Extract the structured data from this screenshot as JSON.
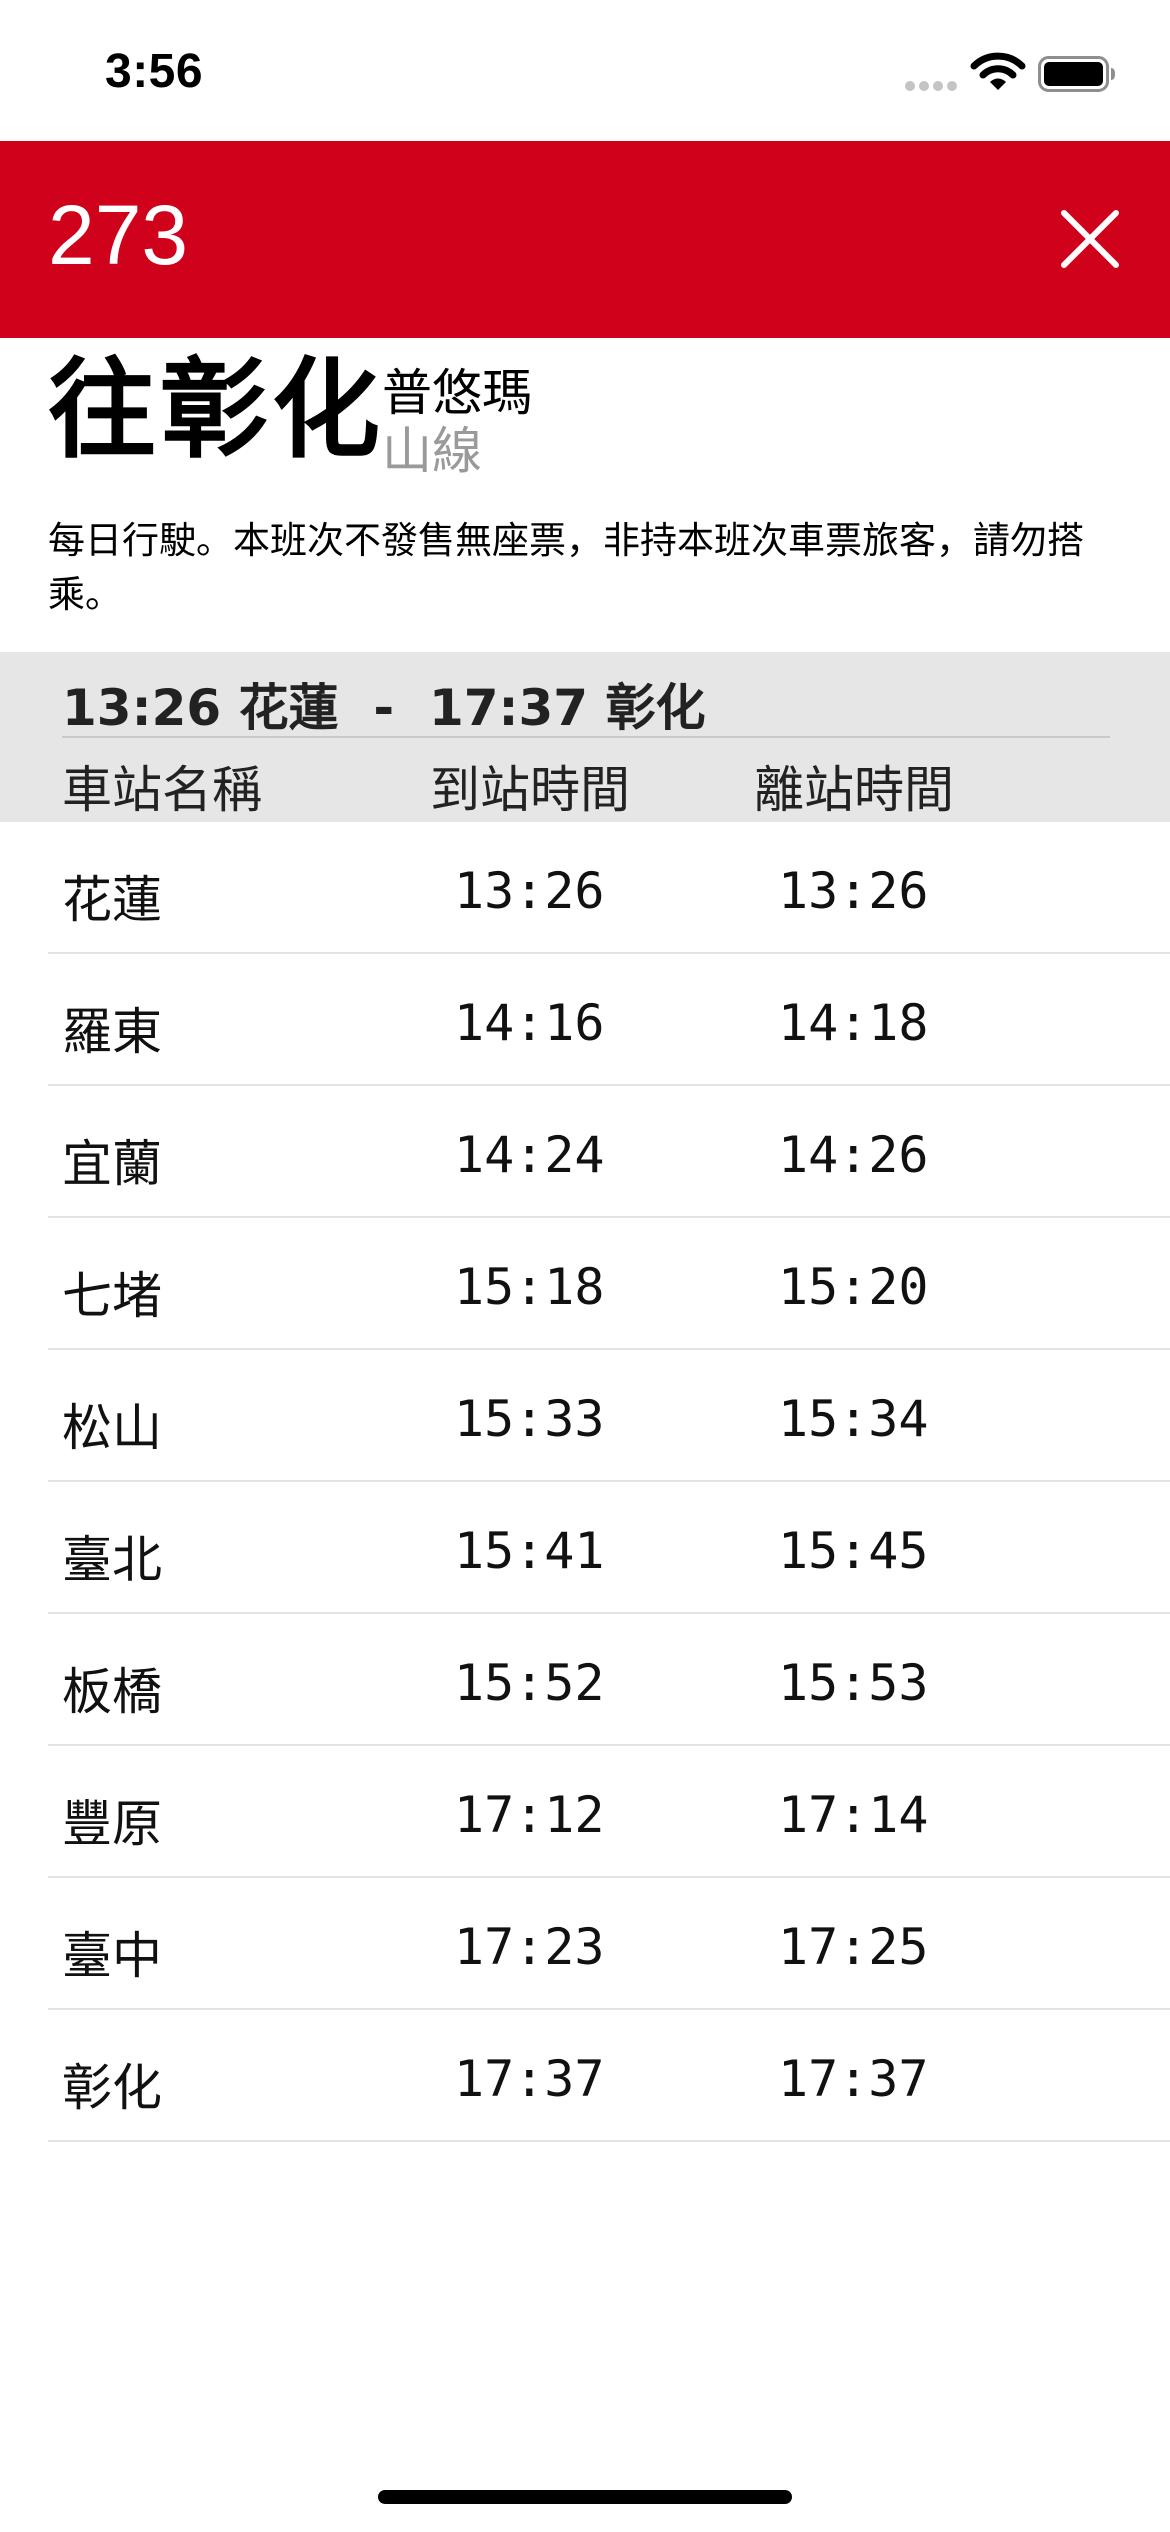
{
  "status_bar": {
    "time": "3:56"
  },
  "header": {
    "train_number": "273",
    "background_color": "#D0021B",
    "close_icon": "close-icon"
  },
  "destination": {
    "title": "往彰化",
    "train_type": "普悠瑪",
    "line_name": "山線"
  },
  "note": "每日行駛。本班次不發售無座票，非持本班次車票旅客，請勿搭乘。",
  "table": {
    "route_summary": "13:26 花蓮  -  17:37 彰化",
    "columns": {
      "station": "車站名稱",
      "arrival": "到站時間",
      "departure": "離站時間"
    },
    "rows": [
      {
        "station": "花蓮",
        "arrival": "13:26",
        "departure": "13:26"
      },
      {
        "station": "羅東",
        "arrival": "14:16",
        "departure": "14:18"
      },
      {
        "station": "宜蘭",
        "arrival": "14:24",
        "departure": "14:26"
      },
      {
        "station": "七堵",
        "arrival": "15:18",
        "departure": "15:20"
      },
      {
        "station": "松山",
        "arrival": "15:33",
        "departure": "15:34"
      },
      {
        "station": "臺北",
        "arrival": "15:41",
        "departure": "15:45"
      },
      {
        "station": "板橋",
        "arrival": "15:52",
        "departure": "15:53"
      },
      {
        "station": "豐原",
        "arrival": "17:12",
        "departure": "17:14"
      },
      {
        "station": "臺中",
        "arrival": "17:23",
        "departure": "17:25"
      },
      {
        "station": "彰化",
        "arrival": "17:37",
        "departure": "17:37"
      }
    ]
  }
}
